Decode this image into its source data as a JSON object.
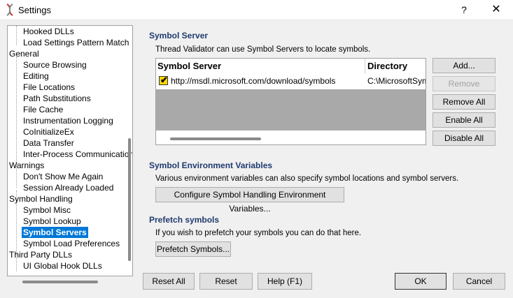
{
  "window": {
    "title": "Settings",
    "help_glyph": "?",
    "close_glyph": "✕"
  },
  "tree": {
    "items": [
      {
        "label": "Hooked DLLs",
        "level": 1
      },
      {
        "label": "Load Settings Pattern Match",
        "level": 1
      },
      {
        "label": "General",
        "level": 0
      },
      {
        "label": "Source Browsing",
        "level": 1
      },
      {
        "label": "Editing",
        "level": 1
      },
      {
        "label": "File Locations",
        "level": 1
      },
      {
        "label": "Path Substitutions",
        "level": 1
      },
      {
        "label": "File Cache",
        "level": 1
      },
      {
        "label": "Instrumentation Logging",
        "level": 1
      },
      {
        "label": "CoInitializeEx",
        "level": 1
      },
      {
        "label": "Data Transfer",
        "level": 1
      },
      {
        "label": "Inter-Process Communication",
        "level": 1
      },
      {
        "label": "Warnings",
        "level": 0
      },
      {
        "label": "Don't Show Me Again",
        "level": 1
      },
      {
        "label": "Session Already Loaded",
        "level": 1
      },
      {
        "label": "Symbol Handling",
        "level": 0
      },
      {
        "label": "Symbol Misc",
        "level": 1
      },
      {
        "label": "Symbol Lookup",
        "level": 1
      },
      {
        "label": "Symbol Servers",
        "level": 1,
        "selected": true
      },
      {
        "label": "Symbol Load Preferences",
        "level": 1
      },
      {
        "label": "Third Party DLLs",
        "level": 0
      },
      {
        "label": "UI Global Hook DLLs",
        "level": 1
      }
    ]
  },
  "symbol_server": {
    "title": "Symbol Server",
    "description": "Thread Validator can use Symbol Servers to locate symbols.",
    "columns": [
      "Symbol Server",
      "Directory"
    ],
    "rows": [
      {
        "checked": true,
        "server": "http://msdl.microsoft.com/download/symbols",
        "directory": "C:\\MicrosoftSym"
      }
    ],
    "buttons": {
      "add": "Add...",
      "remove": "Remove",
      "remove_all": "Remove All",
      "enable_all": "Enable All",
      "disable_all": "Disable All"
    }
  },
  "env_vars": {
    "title": "Symbol Environment Variables",
    "description": "Various environment variables can also specify symbol locations and symbol servers.",
    "button": "Configure Symbol Handling Environment Variables..."
  },
  "prefetch": {
    "title": "Prefetch symbols",
    "description": "If you wish to prefetch your symbols you can do that here.",
    "button": "Prefetch Symbols..."
  },
  "footer": {
    "reset_all": "Reset All",
    "reset": "Reset",
    "help": "Help (F1)",
    "ok": "OK",
    "cancel": "Cancel"
  },
  "colors": {
    "accent": "#0078d7",
    "section_title": "#1f3a6e",
    "check_fill": "#ffd800"
  }
}
